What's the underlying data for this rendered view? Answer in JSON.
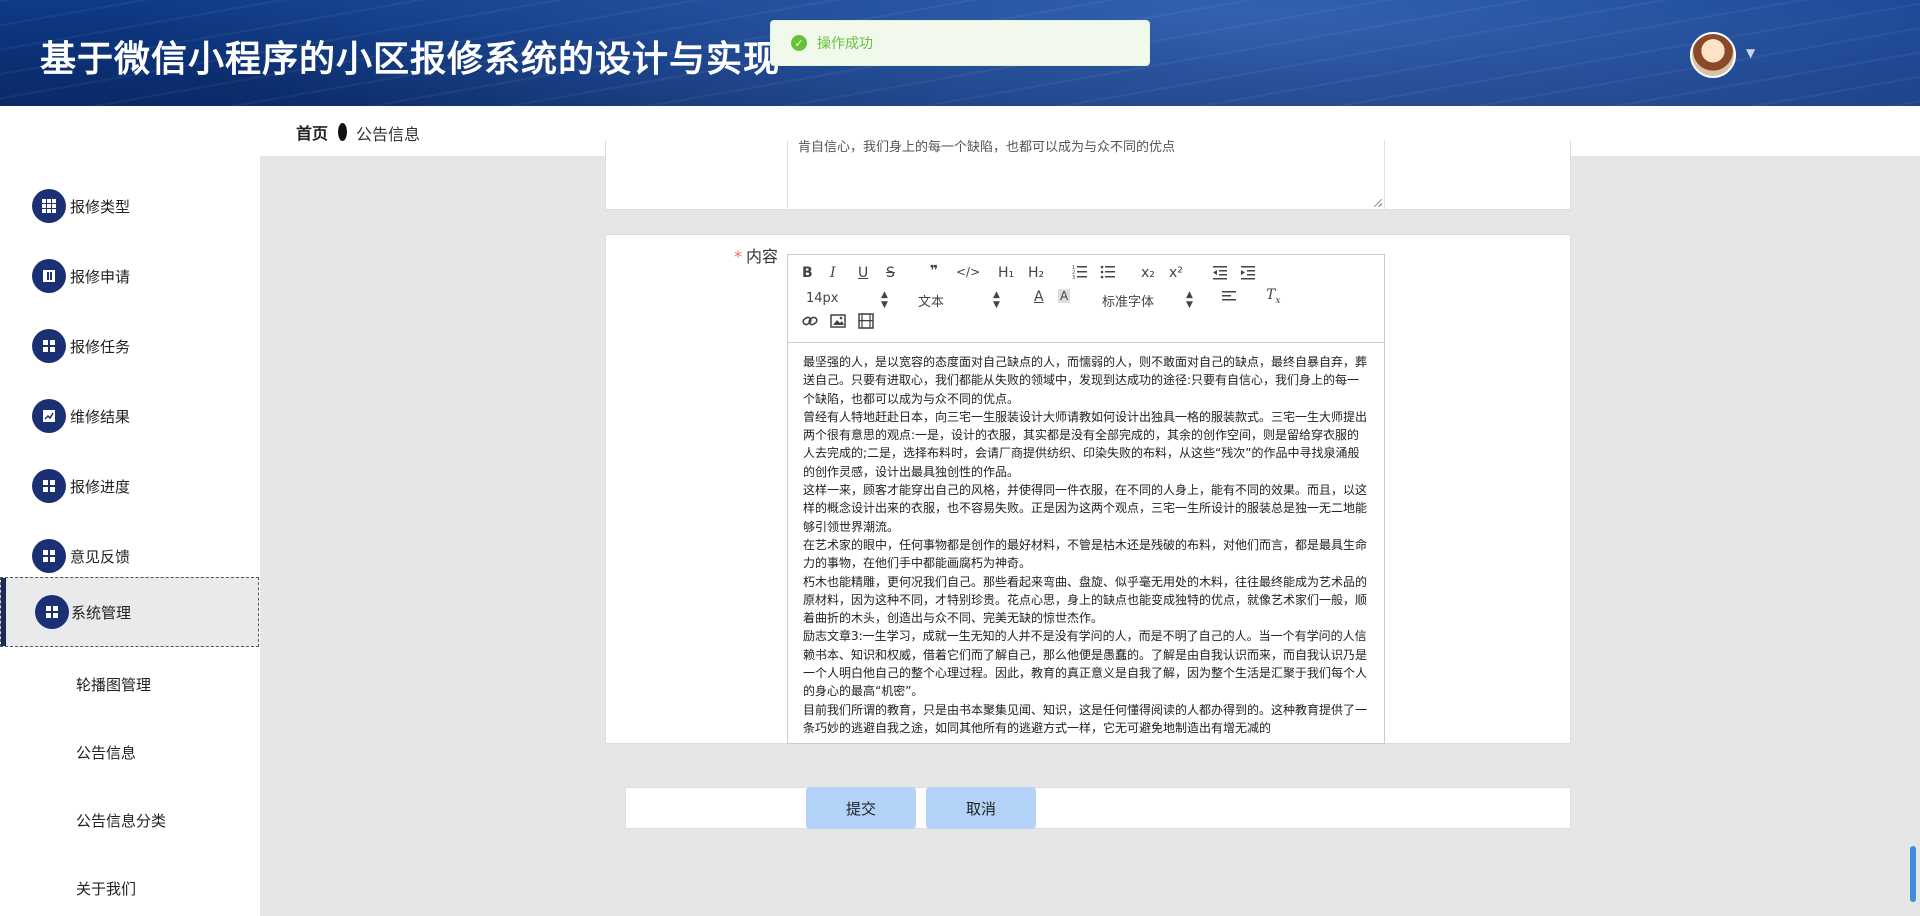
{
  "header": {
    "app_title": "基于微信小程序的小区报修系统的设计与实现"
  },
  "toast": {
    "message": "操作成功",
    "color": "#67c23a"
  },
  "breadcrumb": {
    "home": "首页",
    "current": "公告信息"
  },
  "sidebar": {
    "items": [
      {
        "label": "报修类型",
        "icon": "grid-icon"
      },
      {
        "label": "报修申请",
        "icon": "book-icon"
      },
      {
        "label": "报修任务",
        "icon": "grid-icon"
      },
      {
        "label": "维修结果",
        "icon": "chart-icon"
      },
      {
        "label": "报修进度",
        "icon": "grid-icon"
      },
      {
        "label": "意见反馈",
        "icon": "grid-icon"
      },
      {
        "label": "系统管理",
        "icon": "grid-icon",
        "active": true
      }
    ],
    "sub_items": [
      "轮播图管理",
      "公告信息",
      "公告信息分类",
      "关于我们"
    ]
  },
  "form": {
    "textarea_cut_text": "肯自信心，我们身上的每一个缺陷，也都可以成为与众不同的优点",
    "content_label": "内容",
    "required_mark": "*",
    "toolbar": {
      "bold": "B",
      "italic": "I",
      "underline": "U",
      "strike": "S",
      "quote": "❞",
      "code": "</>",
      "h1": "H₁",
      "h2": "H₂",
      "sub": "x₂",
      "sup": "x²",
      "font_size": "14px",
      "text_type": "文本",
      "font_family": "标准字体"
    },
    "body_paragraphs": [
      "最坚强的人，是以宽容的态度面对自己缺点的人，而懦弱的人，则不敢面对自己的缺点，最终自暴自弃，葬送自己。只要有进取心，我们都能从失败的领域中，发现到达成功的途径:只要有自信心，我们身上的每一个缺陷，也都可以成为与众不同的优点。",
      "曾经有人特地赶赴日本，向三宅一生服装设计大师请教如何设计出独具一格的服装款式。三宅一生大师提出两个很有意思的观点:一是，设计的衣服，其实都是没有全部完成的，其余的创作空间，则是留给穿衣服的人去完成的;二是，选择布料时，会请厂商提供纺织、印染失败的布料，从这些“残次”的作品中寻找泉涌般的创作灵感，设计出最具独创性的作品。",
      "这样一来，顾客才能穿出自己的风格，并使得同一件衣服，在不同的人身上，能有不同的效果。而且，以这样的概念设计出来的衣服，也不容易失败。正是因为这两个观点，三宅一生所设计的服装总是独一无二地能够引领世界潮流。",
      "在艺术家的眼中，任何事物都是创作的最好材料，不管是枯木还是残破的布料，对他们而言，都是最具生命力的事物，在他们手中都能画腐朽为神奇。",
      "朽木也能精雕，更何况我们自己。那些看起来弯曲、盘旋、似乎毫无用处的木料，往往最终能成为艺术品的原材料，因为这种不同，才特别珍贵。花点心思，身上的缺点也能变成独特的优点，就像艺术家们一般，顺着曲折的木头，创造出与众不同、完美无缺的惊世杰作。",
      "励志文章3:一生学习，成就一生无知的人并不是没有学问的人，而是不明了自己的人。当一个有学问的人信赖书本、知识和权威，借着它们而了解自己，那么他便是愚蠢的。了解是由自我认识而来，而自我认识乃是一个人明白他自己的整个心理过程。因此，教育的真正意义是自我了解，因为整个生活是汇聚于我们每个人的身心的最高“机密”。",
      "目前我们所谓的教育，只是由书本聚集见闻、知识，这是任何懂得阅读的人都办得到的。这种教育提供了一条巧妙的逃避自我之途，如同其他所有的逃避方式一样，它无可避免地制造出有增无减的"
    ]
  },
  "buttons": {
    "submit": "提交",
    "cancel": "取消"
  }
}
